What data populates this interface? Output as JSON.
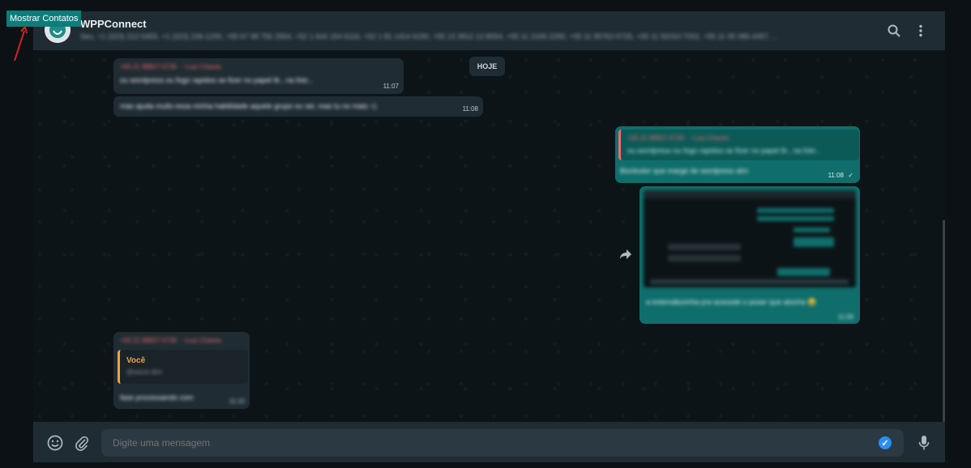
{
  "overlay": {
    "button_label": "Mostrar Contatos",
    "button_color": "#0d7d7a",
    "arrow_color": "#e01e1e"
  },
  "header": {
    "title": "WPPConnect",
    "subtitle": "Seu, +1 (323) 212-5455, +1 (323) 236-1290, +55 67 98 756 2554, +52 1 644 154 6116, +52 1 81 1414 6190, +55 13 3912 12-8054, +55 11 2165-2290, +55 11 95762-5725, +55 11 92010-7002, +55 11 95 086-4457, ...",
    "search_icon": "search-icon",
    "menu_icon": "kebab-menu-icon"
  },
  "chat": {
    "day_label": "HOJE",
    "messages": [
      {
        "sender": "+55 21 98827-5728 · ~Luiz Chaves",
        "text": "ou wordpress ou fogo rapidos se fizer no papel tb , na foto ,",
        "time": "11:07"
      },
      {
        "text": "mas ajuda muito essa minha habilidade aquele grupo ou sei, mas tu no mais =)",
        "time": "11:08"
      },
      {
        "sender": "+55 21 98827-5728 · ~Luiz Chaves",
        "text": "ou wordpress ou fogo rapidos se fizer no papel tb , na foto ,",
        "reply": "Bonitudor que marge de wordpress atm",
        "time": "11:08",
        "ticks": "✓"
      },
      {
        "caption": "a extensãozinha pra acessde o poser que atocha 😂",
        "time": "11:09"
      },
      {
        "sender": "+55 21 98827-5728 · ~Luiz Chaves",
        "quote_name": "Você",
        "quote_text": "@wacio tbm",
        "text": "fase processando com",
        "time": "11:10"
      }
    ]
  },
  "footer": {
    "placeholder": "Digite uma mensagem",
    "emoji_icon": "emoji-icon",
    "attach_icon": "paperclip-icon",
    "mic_icon": "microphone-icon",
    "check_icon": "check-badge-icon"
  }
}
